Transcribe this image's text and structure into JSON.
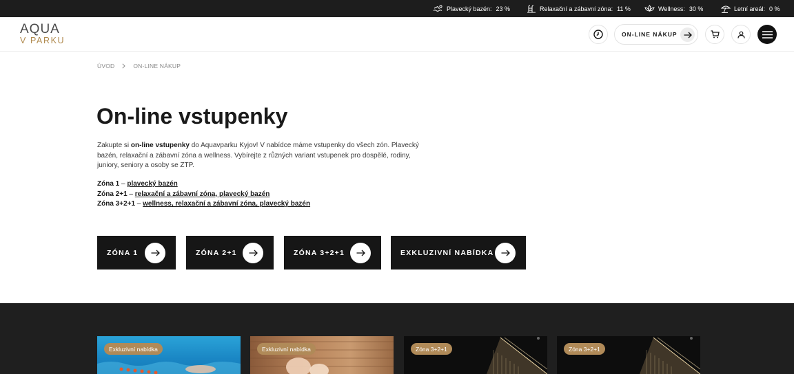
{
  "occupancy": [
    {
      "label": "Plavecký bazén:",
      "value": "23 %",
      "icon": "swimmer-icon"
    },
    {
      "label": "Relaxační a zábavní zóna:",
      "value": "11 %",
      "icon": "pool-ladder-icon"
    },
    {
      "label": "Wellness:",
      "value": "30 %",
      "icon": "lotus-icon"
    },
    {
      "label": "Letní areál:",
      "value": "0 %",
      "icon": "beach-umbrella-icon"
    }
  ],
  "logo": {
    "line1": "AQUA",
    "line2": "V PARKU"
  },
  "header": {
    "online_shop_label": "ON-LINE NÁKUP"
  },
  "breadcrumb": {
    "home": "ÚVOD",
    "current": "ON-LINE NÁKUP"
  },
  "main": {
    "title": "On-line vstupenky",
    "intro_1": "Zakupte si ",
    "intro_bold": "on-line vstupenky",
    "intro_2": " do Aquavparku Kyjov! V nabídce máme vstupenky do všech zón. Plavecký bazén, relaxační a zábavní zóna a wellness. Vybírejte z různých variant vstupenek pro dospělé, rodiny, juniory, seniory a osoby se ZTP.",
    "zones": [
      {
        "name": "Zóna 1",
        "dash": " – ",
        "link": "plavecký bazén"
      },
      {
        "name": "Zóna 2+1",
        "dash": " – ",
        "link": "relaxační a zábavní zóna, plavecký bazén"
      },
      {
        "name": "Zóna 3+2+1",
        "dash": " – ",
        "link": "wellness, relaxační a zábavní zóna, plavecký bazén"
      }
    ],
    "buttons": [
      "ZÓNA 1",
      "ZÓNA 2+1",
      "ZÓNA 3+2+1",
      "EXKLUZIVNÍ NABÍDKA"
    ]
  },
  "cards": [
    {
      "badge": "Exkluzivní nabídka"
    },
    {
      "badge": "Exkluzivní nabídka"
    },
    {
      "badge": "Zóna 3+2+1"
    },
    {
      "badge": "Zóna 3+2+1"
    }
  ],
  "colors": {
    "accent": "#b08a58",
    "dark": "#1f1f1f",
    "topbar": "#1d1d1d"
  }
}
